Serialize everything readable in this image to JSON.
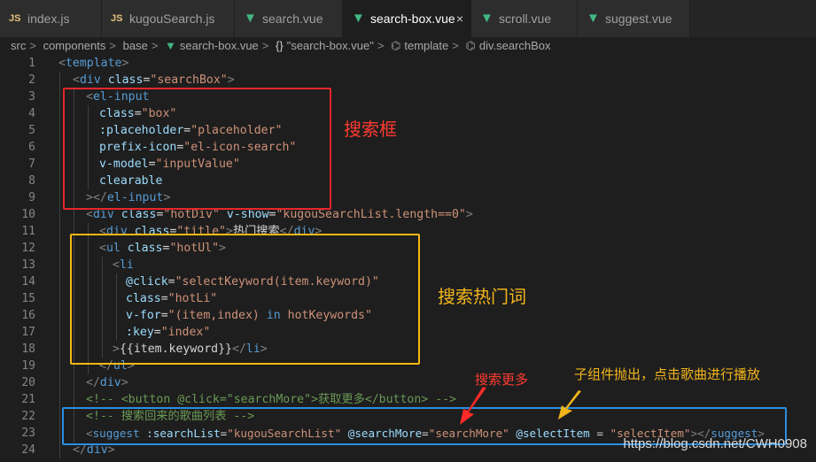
{
  "tabs": [
    {
      "icon": "JS",
      "label": "index.js"
    },
    {
      "icon": "JS",
      "label": "kugouSearch.js"
    },
    {
      "icon": "V",
      "label": "search.vue"
    },
    {
      "icon": "V",
      "label": "search-box.vue",
      "active": true,
      "close": "×"
    },
    {
      "icon": "V",
      "label": "scroll.vue"
    },
    {
      "icon": "V",
      "label": "suggest.vue"
    }
  ],
  "breadcrumb": {
    "src": "src",
    "components": "components",
    "base": "base",
    "file": "search-box.vue",
    "braces": "{}",
    "component": "\"search-box.vue\"",
    "template": "template",
    "div": "div.searchBox",
    "sep": ">"
  },
  "line_numbers": [
    "1",
    "2",
    "3",
    "4",
    "5",
    "6",
    "7",
    "8",
    "9",
    "10",
    "11",
    "12",
    "13",
    "14",
    "15",
    "16",
    "17",
    "18",
    "19",
    "20",
    "21",
    "22",
    "23",
    "24"
  ],
  "code": {
    "l1": {
      "open": "<",
      "tag": "template",
      "close": ">"
    },
    "l2": {
      "open": "<",
      "tag": "div",
      "attr": "class",
      "eq": "=",
      "val": "\"searchBox\"",
      "close": ">"
    },
    "l3": {
      "open": "<",
      "tag": "el-input"
    },
    "l4": {
      "attr": "class",
      "eq": "=",
      "val": "\"box\""
    },
    "l5": {
      "attr": ":placeholder",
      "eq": "=",
      "val": "\"placeholder\""
    },
    "l6": {
      "attr": "prefix-icon",
      "eq": "=",
      "val": "\"el-icon-search\""
    },
    "l7": {
      "attr": "v-model",
      "eq": "=",
      "val": "\"inputValue\""
    },
    "l8": {
      "attr": "clearable"
    },
    "l9": {
      "a": "></",
      "tag": "el-input",
      "close": ">"
    },
    "l10": {
      "open": "<",
      "tag": "div",
      "attr1": "class",
      "eq": "=",
      "val1": "\"hotDiv\"",
      "attr2": "v-show",
      "val2": "\"kugouSearchList.length==0\"",
      "close": ">"
    },
    "l11": {
      "open": "<",
      "tag": "div",
      "attr": "class",
      "eq": "=",
      "val": "\"title\"",
      "close": ">",
      "text": "热门搜索",
      "endopen": "</",
      "endtag": "div",
      "endclose": ">"
    },
    "l12": {
      "open": "<",
      "tag": "ul",
      "attr": "class",
      "eq": "=",
      "val": "\"hotUl\"",
      "close": ">"
    },
    "l13": {
      "open": "<",
      "tag": "li"
    },
    "l14": {
      "attr": "@click",
      "eq": "=",
      "val": "\"selectKeyword(item.keyword)\""
    },
    "l15": {
      "attr": "class",
      "eq": "=",
      "val": "\"hotLi\""
    },
    "l16": {
      "attr": "v-for",
      "eq": "=",
      "q1": "\"(item,index) ",
      "kw": "in",
      "q2": " hotKeywords\""
    },
    "l17": {
      "attr": ":key",
      "eq": "=",
      "val": "\"index\""
    },
    "l18": {
      "a": ">",
      "text": "{{item.keyword}}",
      "endopen": "</",
      "endtag": "li",
      "endclose": ">"
    },
    "l19": {
      "open": "</",
      "tag": "ul",
      "close": ">"
    },
    "l20": {
      "open": "</",
      "tag": "div",
      "close": ">"
    },
    "l21": {
      "comment": "<!-- <button @click=\"searchMore\">获取更多</button> -->"
    },
    "l22": {
      "comment": "<!-- 搜索回来的歌曲列表 -->"
    },
    "l23": {
      "open": "<",
      "tag": "suggest",
      "attr1": ":searchList",
      "eq": "=",
      "val1": "\"kugouSearchList\"",
      "attr2": "@searchMore",
      "val2": "\"searchMore\"",
      "attr3": "@selectItem",
      "eq3": " = ",
      "val3": "\"selectItem\"",
      "endopen": "></",
      "endtag": "suggest",
      "endclose": ">"
    },
    "l24": {
      "open": "</",
      "tag": "div",
      "close": ">"
    }
  },
  "annotations": {
    "search_box": "搜索框",
    "hot_words": "搜索热门词",
    "search_more": "搜索更多",
    "child_emit": "子组件抛出，点击歌曲进行播放"
  },
  "colors": {
    "red_box": "#e8262b",
    "orange_box": "#f5b812",
    "blue_box": "#2b8ee0",
    "red_text": "#ff3b30",
    "orange_text": "#f2b51b"
  },
  "watermark": "https://blog.csdn.net/CWH0908"
}
